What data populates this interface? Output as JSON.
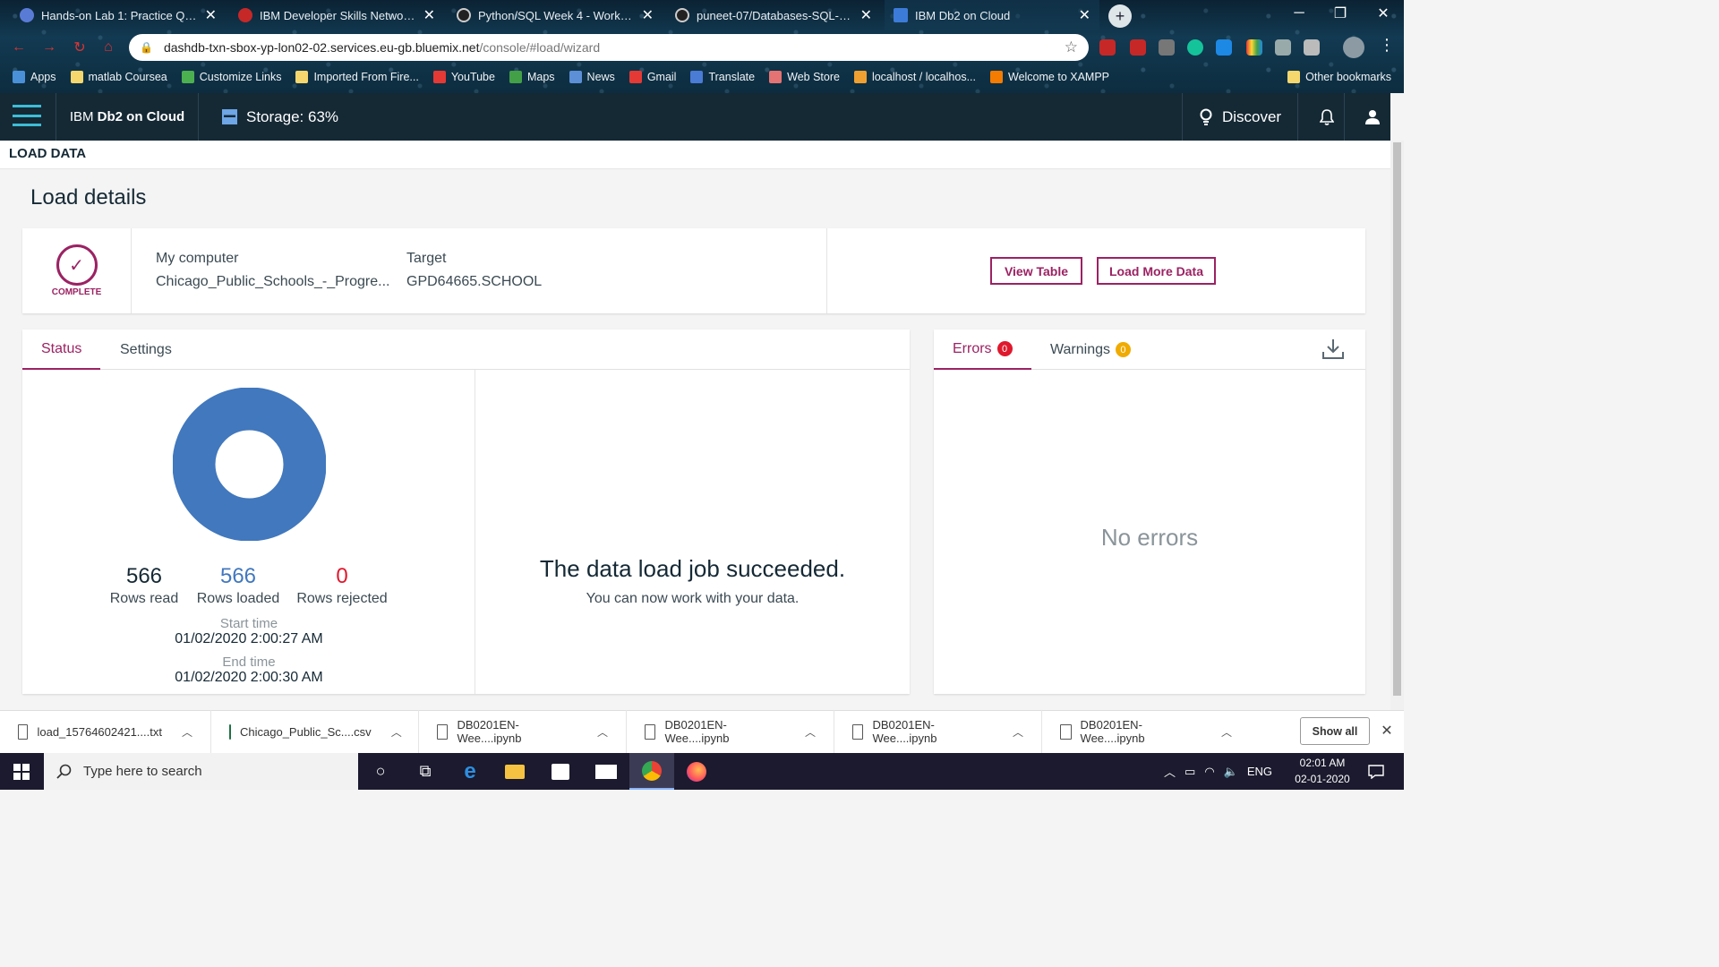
{
  "browser": {
    "tabs": [
      {
        "title": "Hands-on Lab 1: Practice Queryin",
        "icon_color": "#5a7bd5"
      },
      {
        "title": "IBM Developer Skills Network - L",
        "icon_color": "#c62828"
      },
      {
        "title": "Python/SQL Week 4 - Working w",
        "icon_color": "#222222"
      },
      {
        "title": "puneet-07/Databases-SQL-for-D",
        "icon_color": "#222222"
      },
      {
        "title": "IBM Db2 on Cloud",
        "icon_color": "#3d7bd9"
      }
    ],
    "address": {
      "host": "dashdb-txn-sbox-yp-lon02-02.services.eu-gb.bluemix.net",
      "path": "/console/#load/wizard"
    },
    "bookmarks": [
      {
        "label": "Apps",
        "color": "#4a90d9"
      },
      {
        "label": "matlab Coursea",
        "color": "#f5d76e"
      },
      {
        "label": "Customize Links",
        "color": "#4caf50"
      },
      {
        "label": "Imported From Fire...",
        "color": "#f5d76e"
      },
      {
        "label": "YouTube",
        "color": "#e53935"
      },
      {
        "label": "Maps",
        "color": "#43a047"
      },
      {
        "label": "News",
        "color": "#5c8fd6"
      },
      {
        "label": "Gmail",
        "color": "#e53935"
      },
      {
        "label": "Translate",
        "color": "#4a7bd5"
      },
      {
        "label": "Web Store",
        "color": "#e57373"
      },
      {
        "label": "localhost / localhos...",
        "color": "#f0a030"
      },
      {
        "label": "Welcome to XAMPP",
        "color": "#f57c00"
      }
    ],
    "other_bookmarks": "Other bookmarks"
  },
  "header": {
    "brand_prefix": "IBM",
    "brand_name": "Db2 on Cloud",
    "storage": "Storage: 63%",
    "discover": "Discover"
  },
  "page": {
    "title": "LOAD DATA",
    "section": "Load details"
  },
  "summary": {
    "status_label": "COMPLETE",
    "source_label": "My computer",
    "source_value": "Chicago_Public_Schools_-_Progre...",
    "target_label": "Target",
    "target_value": "GPD64665.SCHOOL",
    "view_table": "View Table",
    "load_more": "Load More Data"
  },
  "status_panel": {
    "tabs": [
      "Status",
      "Settings"
    ],
    "rows_read": "566",
    "rows_read_label": "Rows read",
    "rows_loaded": "566",
    "rows_loaded_label": "Rows loaded",
    "rows_rejected": "0",
    "rows_rejected_label": "Rows rejected",
    "start_time_label": "Start time",
    "start_time": "01/02/2020 2:00:27 AM",
    "end_time_label": "End time",
    "end_time": "01/02/2020 2:00:30 AM",
    "success_title": "The data load job succeeded.",
    "success_sub": "You can now work with your data.",
    "loaded_fraction": 1.0,
    "donut_color": "#4178be"
  },
  "errors_panel": {
    "errors_label": "Errors",
    "errors_count": "0",
    "warnings_label": "Warnings",
    "warnings_count": "0",
    "empty": "No errors"
  },
  "downloads": [
    {
      "name": "load_15764602421....txt"
    },
    {
      "name": "Chicago_Public_Sc....csv"
    },
    {
      "name": "DB0201EN-Wee....ipynb"
    },
    {
      "name": "DB0201EN-Wee....ipynb"
    },
    {
      "name": "DB0201EN-Wee....ipynb"
    },
    {
      "name": "DB0201EN-Wee....ipynb"
    }
  ],
  "show_all": "Show all",
  "taskbar": {
    "search_placeholder": "Type here to search",
    "language": "ENG",
    "time": "02:01 AM",
    "date": "02-01-2020"
  },
  "colors": {
    "accent": "#9b2263",
    "header_bg": "#152935",
    "loaded": "#4178be",
    "rejected": "#e0182d",
    "warning": "#f0ab00"
  }
}
